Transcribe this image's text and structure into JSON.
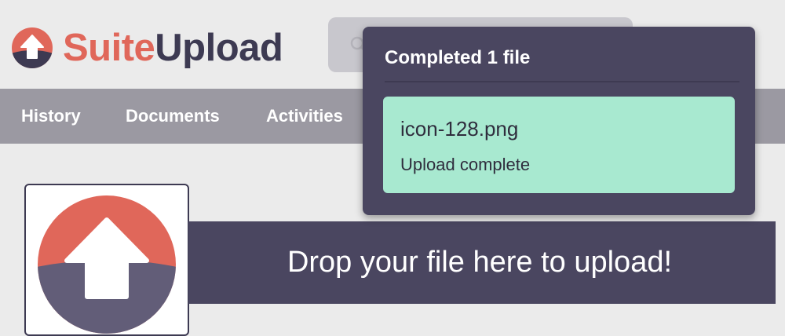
{
  "brand": {
    "name_part1": "Suite",
    "name_part2": "Upload",
    "accent_color": "#e0675a",
    "dark_color": "#3d3a52"
  },
  "search": {
    "icon": "search-icon"
  },
  "nav": {
    "items": [
      {
        "label": "History"
      },
      {
        "label": "Documents"
      },
      {
        "label": "Activities"
      }
    ],
    "bar_color": "#9b99a2"
  },
  "upload_area": {
    "icon": "upload-arrow-icon",
    "drop_text": "Drop your file here to upload!"
  },
  "upload_popup": {
    "title": "Completed 1 file",
    "files": [
      {
        "name": "icon-128.png",
        "status": "Upload complete",
        "status_color": "#a8e9d0"
      }
    ]
  }
}
